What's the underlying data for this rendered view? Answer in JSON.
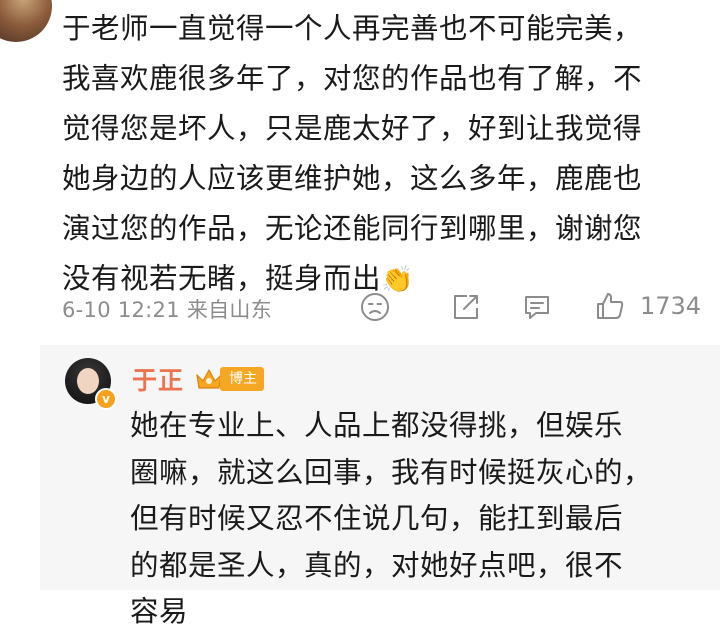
{
  "comment": {
    "lines": [
      "于老师一直觉得一个人再完善也不可能完美，",
      "我喜欢鹿很多年了，对您的作品也有了解，不",
      "觉得您是坏人，只是鹿太好了，好到让我觉得",
      "她身边的人应该更维护她，这么多年，鹿鹿也",
      "演过您的作品，无论还能同行到哪里，谢谢您",
      "没有视若无睹，挺身而出"
    ],
    "emoji": "👏",
    "timestamp": "6-10 12:21 来自山东",
    "like_count": "1734",
    "icons": [
      "sad-face-icon",
      "share-icon",
      "comment-icon",
      "thumbs-up-icon"
    ]
  },
  "reply": {
    "username": "于正",
    "badge": "博主",
    "verify_mark": "v",
    "lines": [
      "她在专业上、人品上都没得挑，但娱乐",
      "圈嘛，就这么回事，我有时候挺灰心的，",
      "但有时候又忍不住说几句，能扛到最后",
      "的都是圣人，真的，对她好点吧，很不",
      "容易"
    ]
  },
  "colors": {
    "username": "#eb7350",
    "badge": "#f5a623",
    "meta": "#8c8c8c",
    "reply_bg": "#f6f6f6"
  }
}
